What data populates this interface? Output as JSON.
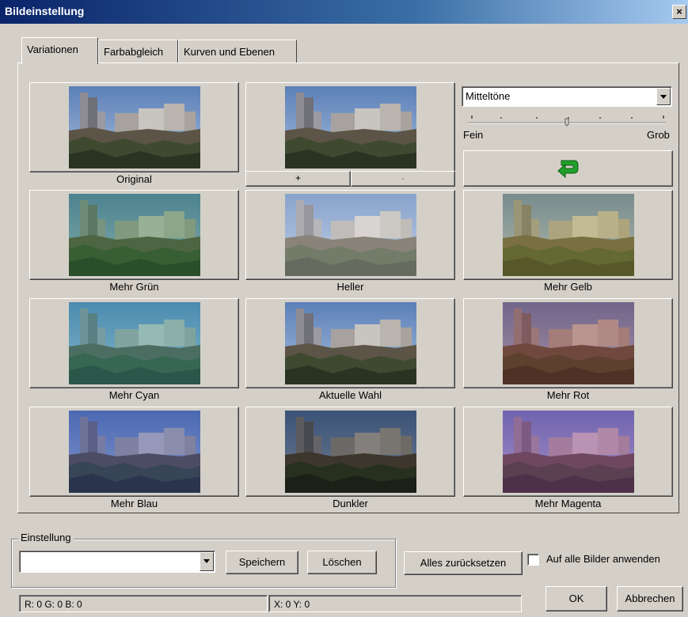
{
  "window": {
    "title": "Bildeinstellung",
    "close_glyph": "×"
  },
  "tabs": [
    {
      "label": "Variationen",
      "active": true
    },
    {
      "label": "Farbabgleich",
      "active": false
    },
    {
      "label": "Kurven und Ebenen",
      "active": false
    }
  ],
  "variations": {
    "original": "Original",
    "plus": "+",
    "minus": "-",
    "items": [
      {
        "label": "Mehr Grün",
        "tint": "#2f8a3a"
      },
      {
        "label": "Heller",
        "tint": "#ffffff"
      },
      {
        "label": "Mehr Gelb",
        "tint": "#b8a838"
      },
      {
        "label": "Mehr Cyan",
        "tint": "#2aa4a0"
      },
      {
        "label": "Aktuelle Wahl",
        "tint": "none"
      },
      {
        "label": "Mehr Rot",
        "tint": "#a0302a"
      },
      {
        "label": "Mehr Blau",
        "tint": "#2a3aa8"
      },
      {
        "label": "Dunkler",
        "tint": "#000000"
      },
      {
        "label": "Mehr Magenta",
        "tint": "#9a2a9a"
      }
    ]
  },
  "tone": {
    "selected": "Mitteltöne",
    "slider_min_label": "Fein",
    "slider_max_label": "Grob",
    "slider_level": 0.5,
    "undo_icon": "undo-arrow-icon",
    "undo_color": "#1fa02a"
  },
  "preset": {
    "group_label": "Einstellung",
    "value": "",
    "save": "Speichern",
    "delete": "Löschen"
  },
  "actions": {
    "reset_all": "Alles zurücksetzen",
    "apply_all": "Auf alle Bilder anwenden",
    "apply_all_checked": false,
    "ok": "OK",
    "cancel": "Abbrechen"
  },
  "statusbar": {
    "rgb": "R:  0 G:  0 B:  0",
    "xy": "X: 0  Y: 0"
  }
}
